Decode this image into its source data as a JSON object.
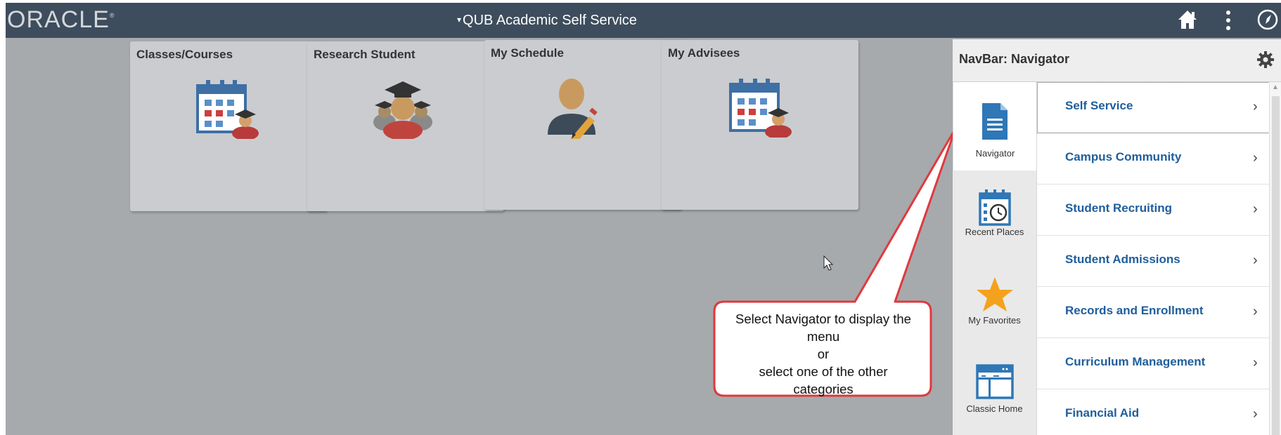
{
  "header": {
    "logo": "ORACLE",
    "logo_mark": "®",
    "title": "QUB Academic Self Service",
    "title_caret": "▾"
  },
  "tiles": [
    {
      "label": "Classes/Courses",
      "icon": "calendar-student-icon"
    },
    {
      "label": "Research Student",
      "icon": "graduates-icon"
    },
    {
      "label": "My Schedule",
      "icon": "person-pencil-icon"
    },
    {
      "label": "My Advisees",
      "icon": "calendar-student-icon"
    }
  ],
  "navbar": {
    "title": "NavBar: Navigator",
    "side_items": [
      {
        "label": "Navigator",
        "icon": "document-icon"
      },
      {
        "label": "Recent Places",
        "icon": "calendar-clock-icon"
      },
      {
        "label": "My Favorites",
        "icon": "star-icon"
      },
      {
        "label": "Classic Home",
        "icon": "window-icon"
      }
    ],
    "menu_items": [
      {
        "label": "Self Service"
      },
      {
        "label": "Campus Community"
      },
      {
        "label": "Student Recruiting"
      },
      {
        "label": "Student Admissions"
      },
      {
        "label": "Records and Enrollment"
      },
      {
        "label": "Curriculum Management"
      },
      {
        "label": "Financial Aid"
      }
    ],
    "chevron": "›"
  },
  "callout": {
    "line1": "Select Navigator to display the",
    "line2": "menu",
    "line3": "or",
    "line4": "select one of the other",
    "line5": "categories"
  },
  "colors": {
    "topbar": "#3e4d5d",
    "background": "#a6aaad",
    "link": "#1f5e9c",
    "accent_blue": "#2f77b6",
    "callout_border": "#e0393e",
    "star": "#f4a21d"
  }
}
